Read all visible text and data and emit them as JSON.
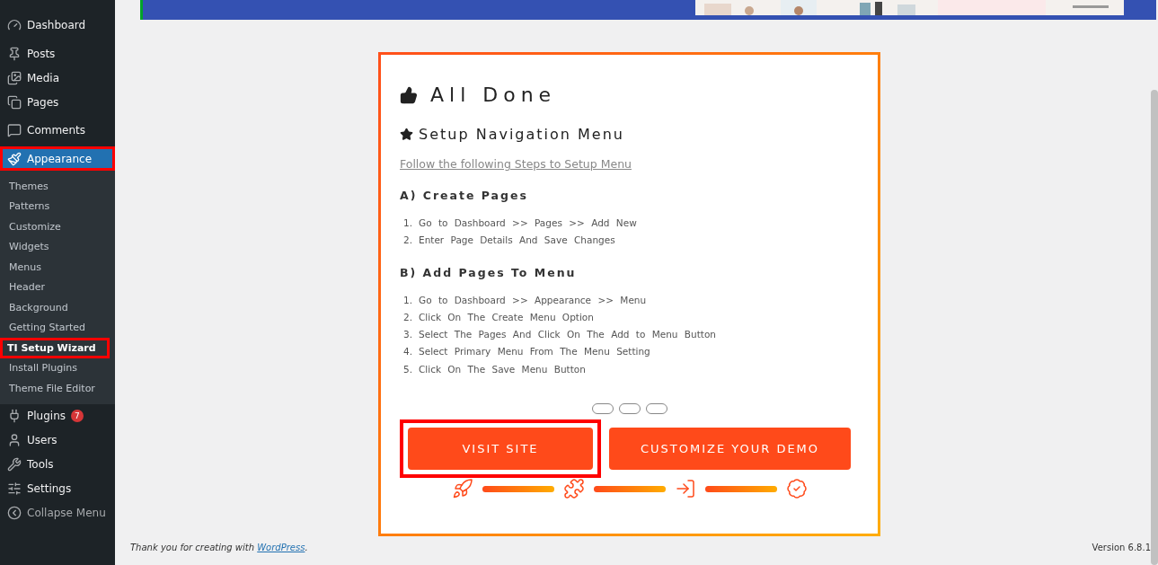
{
  "sidebar": {
    "items": [
      {
        "label": "Dashboard",
        "selected": false,
        "highlighted": false
      },
      {
        "label": "Posts",
        "selected": false,
        "highlighted": false
      },
      {
        "label": "Media",
        "selected": false,
        "highlighted": false
      },
      {
        "label": "Pages",
        "selected": false,
        "highlighted": false
      },
      {
        "label": "Comments",
        "selected": false,
        "highlighted": false
      },
      {
        "label": "Appearance",
        "selected": true,
        "highlighted": true,
        "children": [
          {
            "label": "Themes",
            "selected": false,
            "highlighted": false
          },
          {
            "label": "Patterns",
            "selected": false,
            "highlighted": false
          },
          {
            "label": "Customize",
            "selected": false,
            "highlighted": false
          },
          {
            "label": "Widgets",
            "selected": false,
            "highlighted": false
          },
          {
            "label": "Menus",
            "selected": false,
            "highlighted": false
          },
          {
            "label": "Header",
            "selected": false,
            "highlighted": false
          },
          {
            "label": "Background",
            "selected": false,
            "highlighted": false
          },
          {
            "label": "Getting Started",
            "selected": false,
            "highlighted": false
          },
          {
            "label": "TI Setup Wizard",
            "selected": true,
            "highlighted": true
          },
          {
            "label": "Install Plugins",
            "selected": false,
            "highlighted": false
          },
          {
            "label": "Theme File Editor",
            "selected": false,
            "highlighted": false
          }
        ]
      },
      {
        "label": "Plugins",
        "selected": false,
        "highlighted": false,
        "badge": "7"
      },
      {
        "label": "Users",
        "selected": false,
        "highlighted": false
      },
      {
        "label": "Tools",
        "selected": false,
        "highlighted": false
      },
      {
        "label": "Settings",
        "selected": false,
        "highlighted": false
      }
    ],
    "collapse": "Collapse Menu"
  },
  "wizard": {
    "title": "All Done",
    "subtitle": "Setup Navigation Menu",
    "link": "Follow the following Steps to Setup Menu",
    "sections": [
      {
        "heading": "A) Create Pages",
        "steps": [
          {
            "number": "1.",
            "text": "Go to Dashboard >> Pages >> Add New"
          },
          {
            "number": "2.",
            "text": "Enter Page Details And Save Changes"
          }
        ]
      },
      {
        "heading": "B) Add Pages To Menu",
        "steps": [
          {
            "number": "1.",
            "text": "Go to Dashboard >> Appearance >> Menu"
          },
          {
            "number": "2.",
            "text": "Click On The Create Menu Option"
          },
          {
            "number": "3.",
            "text": "Select The Pages And Click On The Add to Menu Button"
          },
          {
            "number": "4.",
            "text": "Select Primary Menu From The Menu Setting"
          },
          {
            "number": "5.",
            "text": "Click On The Save Menu Button"
          }
        ]
      }
    ],
    "buttons": [
      {
        "label": "VISIT SITE",
        "highlighted": true
      },
      {
        "label": "CUSTOMIZE YOUR DEMO",
        "highlighted": false
      }
    ],
    "progress": [
      {
        "level": 1
      },
      {
        "level": 1
      },
      {
        "level": 1
      }
    ]
  },
  "footer": {
    "thanks_before": "Thank you for creating with",
    "link": "WordPress",
    "thanks_after": ".",
    "version": "Version 6.8.1"
  }
}
